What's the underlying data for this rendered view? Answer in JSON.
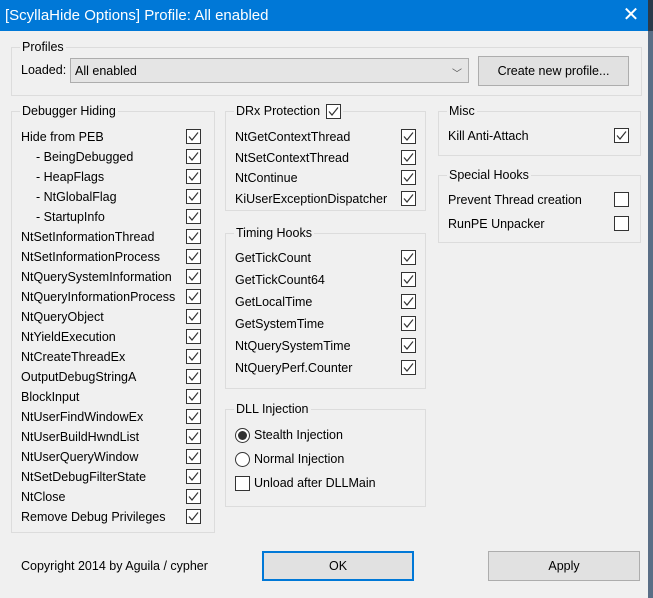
{
  "title": "[ScyllaHide Options] Profile: All enabled",
  "profiles": {
    "label": "Profiles",
    "loaded_label": "Loaded:",
    "selected": "All enabled",
    "create_button": "Create new profile..."
  },
  "debugger_hiding": {
    "label": "Debugger Hiding",
    "items": [
      {
        "label": "Hide from PEB",
        "checked": true,
        "indent": false
      },
      {
        "label": "- BeingDebugged",
        "checked": true,
        "indent": true
      },
      {
        "label": "- HeapFlags",
        "checked": true,
        "indent": true
      },
      {
        "label": "- NtGlobalFlag",
        "checked": true,
        "indent": true
      },
      {
        "label": "- StartupInfo",
        "checked": true,
        "indent": true
      },
      {
        "label": "NtSetInformationThread",
        "checked": true,
        "indent": false
      },
      {
        "label": "NtSetInformationProcess",
        "checked": true,
        "indent": false
      },
      {
        "label": "NtQuerySystemInformation",
        "checked": true,
        "indent": false
      },
      {
        "label": "NtQueryInformationProcess",
        "checked": true,
        "indent": false
      },
      {
        "label": "NtQueryObject",
        "checked": true,
        "indent": false
      },
      {
        "label": "NtYieldExecution",
        "checked": true,
        "indent": false
      },
      {
        "label": "NtCreateThreadEx",
        "checked": true,
        "indent": false
      },
      {
        "label": "OutputDebugStringA",
        "checked": true,
        "indent": false
      },
      {
        "label": "BlockInput",
        "checked": true,
        "indent": false
      },
      {
        "label": "NtUserFindWindowEx",
        "checked": true,
        "indent": false
      },
      {
        "label": "NtUserBuildHwndList",
        "checked": true,
        "indent": false
      },
      {
        "label": "NtUserQueryWindow",
        "checked": true,
        "indent": false
      },
      {
        "label": "NtSetDebugFilterState",
        "checked": true,
        "indent": false
      },
      {
        "label": "NtClose",
        "checked": true,
        "indent": false
      },
      {
        "label": "Remove Debug Privileges",
        "checked": true,
        "indent": false
      }
    ]
  },
  "drx": {
    "label": "DRx Protection",
    "checked": true,
    "items": [
      {
        "label": "NtGetContextThread",
        "checked": true
      },
      {
        "label": "NtSetContextThread",
        "checked": true
      },
      {
        "label": "NtContinue",
        "checked": true
      },
      {
        "label": "KiUserExceptionDispatcher",
        "checked": true
      }
    ]
  },
  "timing": {
    "label": "Timing Hooks",
    "items": [
      {
        "label": "GetTickCount",
        "checked": true
      },
      {
        "label": "GetTickCount64",
        "checked": true
      },
      {
        "label": "GetLocalTime",
        "checked": true
      },
      {
        "label": "GetSystemTime",
        "checked": true
      },
      {
        "label": "NtQuerySystemTime",
        "checked": true
      },
      {
        "label": "NtQueryPerf.Counter",
        "checked": true
      }
    ]
  },
  "dll": {
    "label": "DLL Injection",
    "stealth": "Stealth Injection",
    "normal": "Normal Injection",
    "selected": "stealth",
    "unload": "Unload after DLLMain",
    "unload_checked": false
  },
  "misc": {
    "label": "Misc",
    "items": [
      {
        "label": "Kill Anti-Attach",
        "checked": true
      }
    ]
  },
  "special": {
    "label": "Special Hooks",
    "items": [
      {
        "label": "Prevent Thread creation",
        "checked": false
      },
      {
        "label": "RunPE Unpacker",
        "checked": false
      }
    ]
  },
  "footer": {
    "copyright": "Copyright 2014 by Aguila / cypher",
    "ok": "OK",
    "apply": "Apply"
  }
}
